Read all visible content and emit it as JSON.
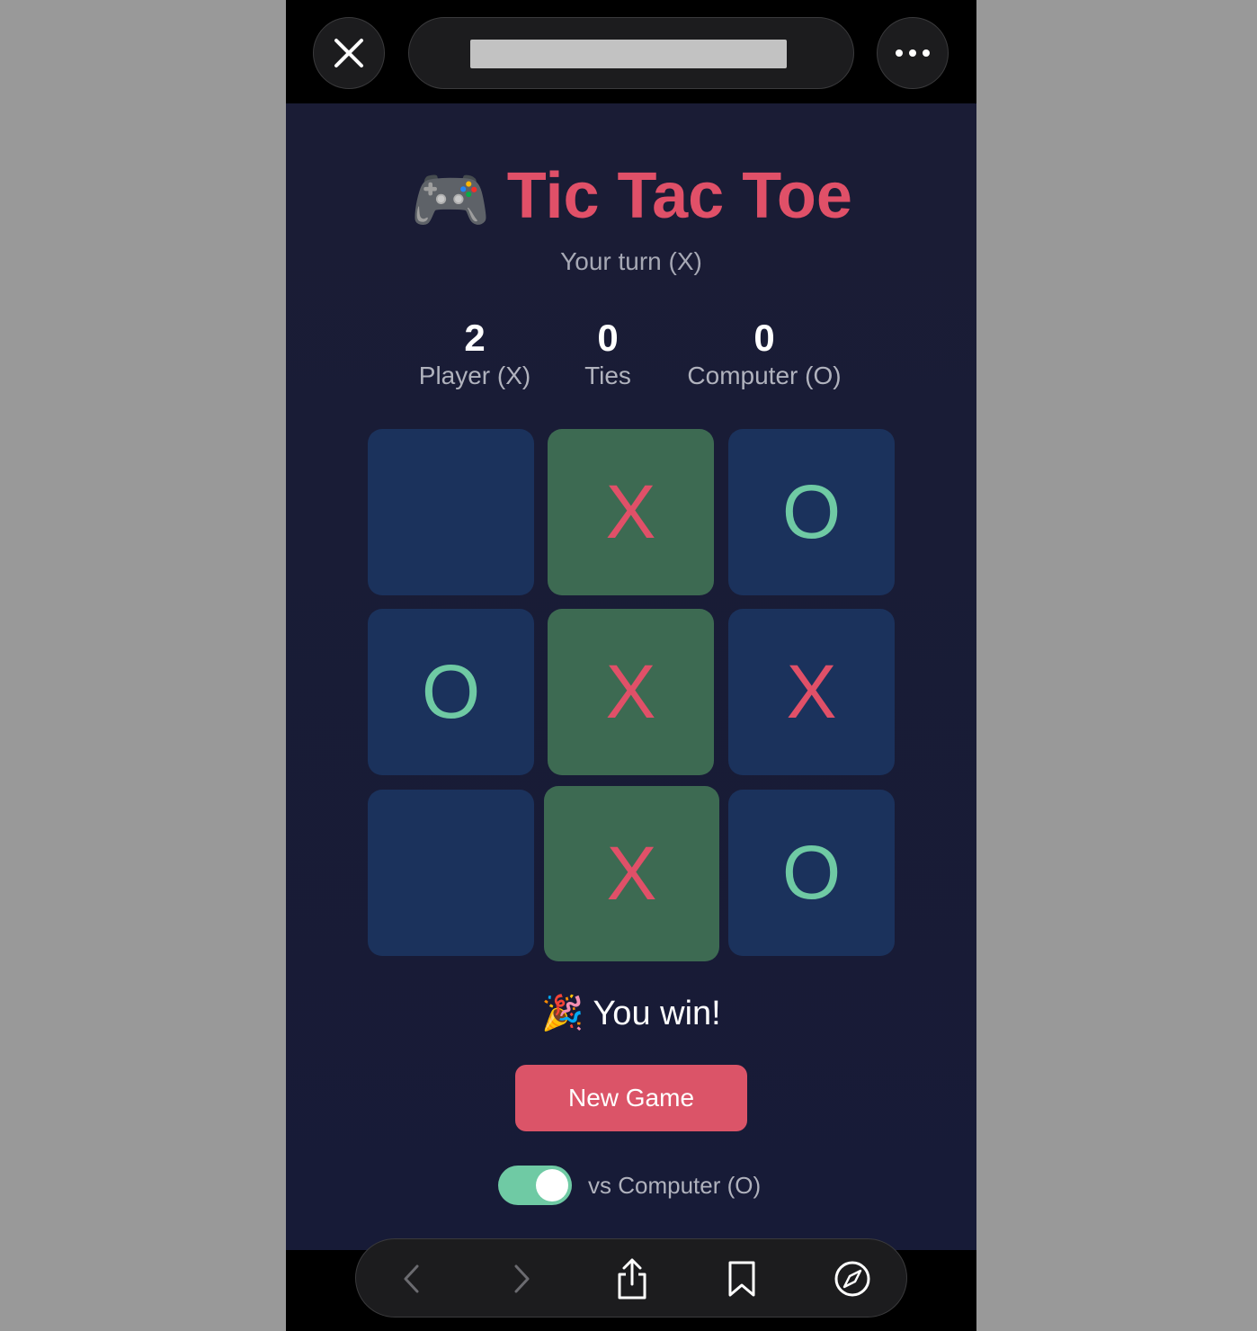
{
  "browser": {
    "url": "",
    "close_icon": "close-icon",
    "more_icon": "more-icon",
    "nav_icons": [
      "back-icon",
      "forward-icon",
      "share-icon",
      "bookmark-icon",
      "compass-icon"
    ]
  },
  "game": {
    "title_emoji": "🎮",
    "title": "Tic Tac Toe",
    "status": "Your turn (X)",
    "scores": {
      "player": {
        "value": "2",
        "label": "Player (X)"
      },
      "ties": {
        "value": "0",
        "label": "Ties"
      },
      "computer": {
        "value": "0",
        "label": "Computer (O)"
      }
    },
    "board": [
      "",
      "X",
      "O",
      "O",
      "X",
      "X",
      "",
      "X",
      "O"
    ],
    "winning_cells": [
      1,
      4,
      7
    ],
    "result": "🎉 You win!",
    "new_game_label": "New Game",
    "mode_toggle": {
      "on": true,
      "label": "vs Computer (O)"
    }
  },
  "colors": {
    "accent": "#e05068",
    "o_color": "#6fcaa4",
    "cell": "#1b325c",
    "win_cell": "#3d6a52",
    "background": "#1a1c35"
  }
}
